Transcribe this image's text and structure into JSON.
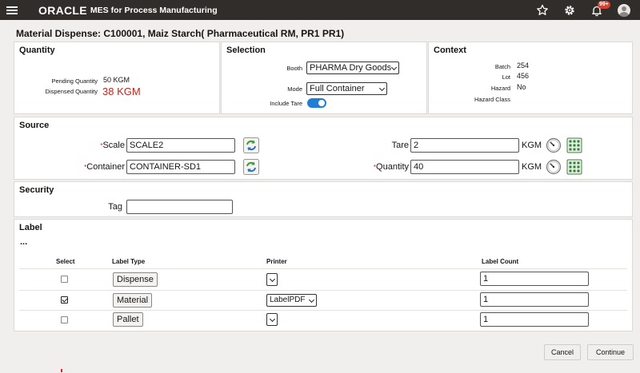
{
  "header": {
    "logo": "ORACLE",
    "app_name": "MES for Process Manufacturing",
    "notification_badge": "99+"
  },
  "page_title": "Material Dispense: C100001, Maiz Starch( Pharmaceutical RM, PR1 PR1)",
  "quantity": {
    "title": "Quantity",
    "pending_label": "Pending Quantity",
    "pending_value": "50 KGM",
    "dispensed_label": "Dispensed Quantity",
    "dispensed_value": "38 KGM"
  },
  "selection": {
    "title": "Selection",
    "booth_label": "Booth",
    "booth_value": "PHARMA Dry Goods",
    "mode_label": "Mode",
    "mode_value": "Full Container",
    "include_tare_label": "Include Tare",
    "include_tare_on": true
  },
  "context": {
    "title": "Context",
    "batch_label": "Batch",
    "batch_value": "254",
    "lot_label": "Lot",
    "lot_value": "456",
    "hazard_label": "Hazard",
    "hazard_value": "No",
    "hazard_class_label": "Hazard Class",
    "hazard_class_value": ""
  },
  "source": {
    "title": "Source",
    "scale_label": "Scale",
    "scale_value": "SCALE2",
    "container_label": "Container",
    "container_value": "CONTAINER-SD1",
    "tare_label": "Tare",
    "tare_value": "2",
    "tare_unit": "KGM",
    "quantity_label": "Quantity",
    "quantity_value": "40",
    "quantity_unit": "KGM"
  },
  "security": {
    "title": "Security",
    "tag_label": "Tag",
    "tag_value": ""
  },
  "label": {
    "title": "Label",
    "more": "...",
    "columns": {
      "select": "Select",
      "label_type": "Label Type",
      "printer": "Printer",
      "label_count": "Label Count"
    },
    "rows": [
      {
        "selected": false,
        "label_type": "Dispense",
        "printer": "",
        "label_count": "1"
      },
      {
        "selected": true,
        "label_type": "Material",
        "printer": "LabelPDF",
        "label_count": "1"
      },
      {
        "selected": false,
        "label_type": "Pallet",
        "printer": "",
        "label_count": "1"
      }
    ]
  },
  "footer": {
    "cancel_label": "Cancel",
    "continue_label": "Continue"
  }
}
